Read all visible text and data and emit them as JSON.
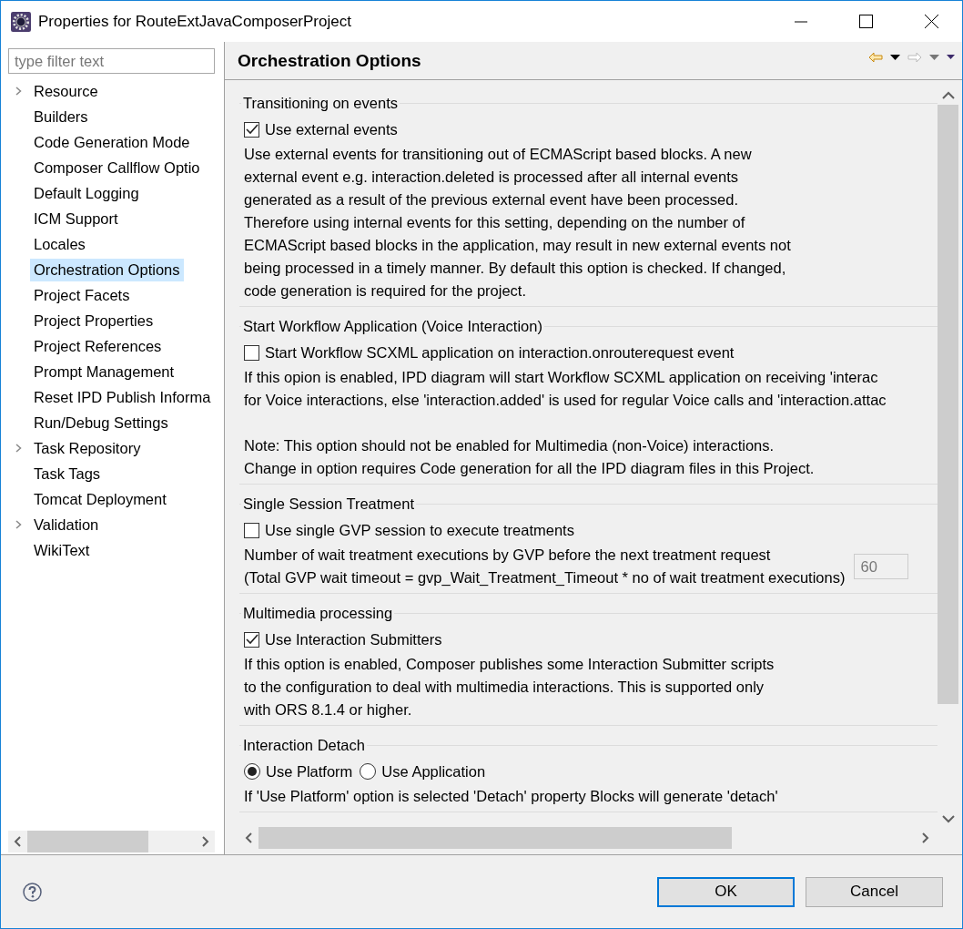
{
  "window": {
    "title": "Properties for RouteExtJavaComposerProject"
  },
  "sidebar": {
    "filter_placeholder": "type filter text",
    "items": [
      {
        "label": "Resource",
        "expandable": true,
        "selected": false
      },
      {
        "label": "Builders",
        "expandable": false,
        "selected": false
      },
      {
        "label": "Code Generation Mode",
        "expandable": false,
        "selected": false
      },
      {
        "label": "Composer Callflow Optio",
        "expandable": false,
        "selected": false
      },
      {
        "label": "Default Logging",
        "expandable": false,
        "selected": false
      },
      {
        "label": "ICM Support",
        "expandable": false,
        "selected": false
      },
      {
        "label": "Locales",
        "expandable": false,
        "selected": false
      },
      {
        "label": "Orchestration Options",
        "expandable": false,
        "selected": true
      },
      {
        "label": "Project Facets",
        "expandable": false,
        "selected": false
      },
      {
        "label": "Project Properties",
        "expandable": false,
        "selected": false
      },
      {
        "label": "Project References",
        "expandable": false,
        "selected": false
      },
      {
        "label": "Prompt Management",
        "expandable": false,
        "selected": false
      },
      {
        "label": "Reset IPD Publish Informa",
        "expandable": false,
        "selected": false
      },
      {
        "label": "Run/Debug Settings",
        "expandable": false,
        "selected": false
      },
      {
        "label": "Task Repository",
        "expandable": true,
        "selected": false
      },
      {
        "label": "Task Tags",
        "expandable": false,
        "selected": false
      },
      {
        "label": "Tomcat Deployment",
        "expandable": false,
        "selected": false
      },
      {
        "label": "Validation",
        "expandable": true,
        "selected": false
      },
      {
        "label": "WikiText",
        "expandable": false,
        "selected": false
      }
    ]
  },
  "page": {
    "title": "Orchestration Options"
  },
  "sections": [
    {
      "title": "Transitioning on events",
      "kind": "checkbox",
      "options": [
        {
          "label": "Use external events",
          "checked": true
        }
      ],
      "description": "Use external events for transitioning out of ECMAScript based blocks. A new\nexternal event e.g. interaction.deleted is processed after all internal events\ngenerated as a result of the previous external event have been processed.\nTherefore using internal events for this setting, depending on the number of\nECMAScript based blocks in the application, may result in new external events not\nbeing processed in a timely manner. By default this option is checked. If changed,\ncode generation is required for the project."
    },
    {
      "title": "Start Workflow Application (Voice Interaction)",
      "kind": "checkbox",
      "options": [
        {
          "label": "Start Workflow SCXML application on interaction.onrouterequest event",
          "checked": false
        }
      ],
      "description": "If this opion is enabled, IPD diagram will start Workflow SCXML application on receiving 'interac\nfor Voice interactions, else 'interaction.added' is used for regular Voice calls and 'interaction.attac\n\nNote: This option should not be enabled for Multimedia (non-Voice) interactions.\nChange in option requires Code generation for all the IPD diagram files in this Project."
    },
    {
      "title": "Single Session Treatment",
      "kind": "checkbox",
      "options": [
        {
          "label": "Use single GVP session to execute treatments",
          "checked": false
        }
      ],
      "description": "Number of wait treatment executions by GVP before the next treatment request\n(Total GVP wait timeout = gvp_Wait_Treatment_Timeout * no of wait treatment executions)",
      "spinner_value": "60"
    },
    {
      "title": "Multimedia processing",
      "kind": "checkbox",
      "options": [
        {
          "label": "Use Interaction Submitters",
          "checked": true
        }
      ],
      "description": "If this option is enabled, Composer publishes some Interaction Submitter scripts\nto the configuration to deal with multimedia interactions. This is supported only\nwith ORS 8.1.4 or higher."
    },
    {
      "title": "Interaction Detach",
      "kind": "radio",
      "options": [
        {
          "label": "Use Platform",
          "checked": true
        },
        {
          "label": "Use Application",
          "checked": false
        }
      ],
      "description": "If 'Use Platform' option is selected 'Detach' property Blocks will generate 'detach'"
    }
  ],
  "buttons": [
    {
      "label": "OK",
      "default": true
    },
    {
      "label": "Cancel",
      "default": false
    }
  ]
}
